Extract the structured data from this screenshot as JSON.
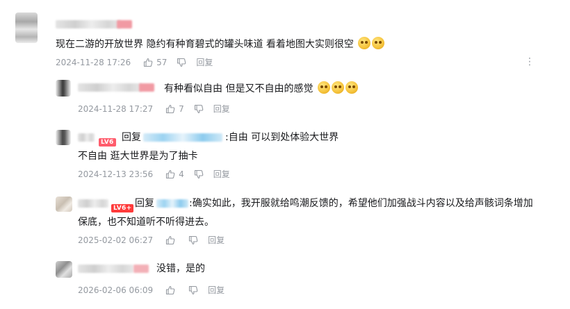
{
  "main_comment": {
    "text": "现在二游的开放世界 隐约有种育碧式的罐头味道 看着地图大实则很空",
    "date": "2024-11-28 17:26",
    "likes": "57",
    "reply_label": "回复",
    "emoji_count_icon": "emoji-face-icon"
  },
  "replies": [
    {
      "text": "有种看似自由 但是又不自由的感觉",
      "date": "2024-11-28 17:27",
      "likes": "7",
      "reply_label": "回复"
    },
    {
      "level": "LV6",
      "reply_prefix": "回复",
      "text_after": ":自由 可以到处体验大世界",
      "text_line2": "不自由 逛大世界是为了抽卡",
      "date": "2024-12-13 23:56",
      "likes": "4",
      "reply_label": "回复"
    },
    {
      "level": "LV6+",
      "reply_prefix": "回复",
      "text_after": ":确实如此，我开服就给鸣潮反馈的，希望他们加强战斗内容以及给声骸词条增加",
      "text_line2": "保底，也不知道听不听得进去。",
      "date": "2025-02-02 06:27",
      "likes": "",
      "reply_label": "回复"
    },
    {
      "text": "没错，是的",
      "date": "2026-02-06 06:09",
      "likes": "",
      "reply_label": "回复"
    }
  ],
  "more_menu": "⋮"
}
